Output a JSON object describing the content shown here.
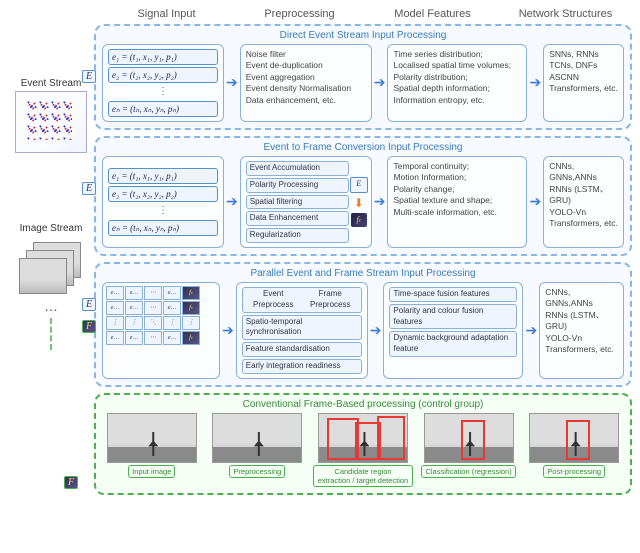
{
  "headers": {
    "signal": "Signal Input",
    "preproc": "Preprocessing",
    "features": "Model Features",
    "nets": "Network Structures"
  },
  "left": {
    "event_stream": "Event Stream",
    "image_stream": "Image Stream",
    "ellipsis": "…",
    "E": "E",
    "F": "F"
  },
  "pipelines": {
    "direct": {
      "title": "Direct Event Stream Input Processing",
      "signal": {
        "e1": "e₁ = (t₁, x₁, y₁, p₁)",
        "e2": "e₂ = (t₂, x₂, y₂, p₂)",
        "dots": "⋮",
        "en": "eₙ = (tₙ, xₙ, yₙ, pₙ)"
      },
      "preproc": "Noise filter\nEvent de-duplication\nEvent aggregation\nEvent density Normalisation\nData enhancement, etc.",
      "features": "Time series distribution;\nLocalised spatial time volumes;\nPolarity distribution;\nSpatial depth information;\nInformation entropy, etc.",
      "nets": "SNNs, RNNs\nTCNs, DNFs\nASCNN\nTransformers, etc."
    },
    "e2f": {
      "title": "Event to Frame Conversion Input Processing",
      "signal": {
        "e1": "e₁ = (t₁, x₁, y₁, p₁)",
        "e2": "e₂ = (t₂, x₂, y₂, p₂)",
        "dots": "⋮",
        "en": "eₙ = (tₙ, xₙ, yₙ, pₙ)"
      },
      "preproc": {
        "a": "Event Accumulation",
        "b": "Polarity Processing",
        "c": "Spatial filtering",
        "d": "Data Enhancement",
        "e": "Regularization",
        "E": "E",
        "ft": "fₜ"
      },
      "features": "Temporal continuity;\nMotion Information;\nPolarity change;\nSpatial texture and shape;\nMulti-scale information, etc.",
      "nets": "CNNs, GNNs,ANNs\nRNNs (LSTM、GRU)\nYOLO-Vn\nTransformers, etc."
    },
    "parallel": {
      "title": "Parallel Event and Frame Stream Input Processing",
      "grid": {
        "e": "e…",
        "f": "fₜ",
        "dots": "⋮"
      },
      "preproc": {
        "a1": "Event Preprocess",
        "a2": "Frame Preprocess",
        "b": "Spatio-temporal synchronisation",
        "c": "Feature standardisation",
        "d": "Early integration readiness"
      },
      "features": {
        "a": "Time-space fusion features",
        "b": "Polarity and colour fusion features",
        "c": "Dynamic background adaptation feature"
      },
      "nets": "CNNs, GNNs,ANNs\nRNNs (LSTM、GRU)\nYOLO-Vn\nTransformers, etc."
    },
    "control": {
      "title": "Conventional Frame-Based processing (control group)",
      "steps": {
        "a": "Input image",
        "b": "Preprocessing",
        "c": "Candidate region extraction / target detection",
        "d": "Classification (regression)",
        "e": "Post-processing"
      }
    }
  }
}
